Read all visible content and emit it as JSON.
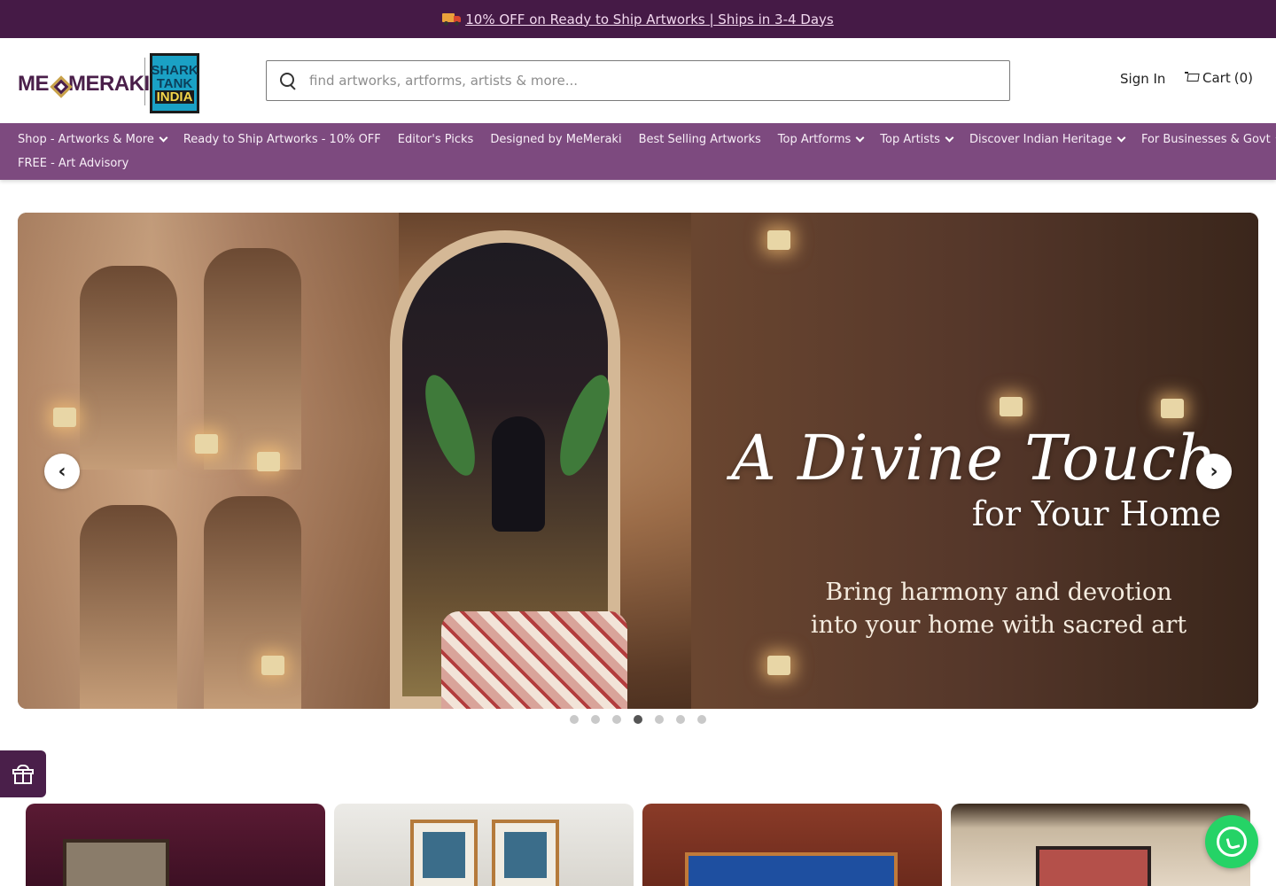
{
  "announcement": {
    "text": "10% OFF on Ready to Ship Artworks | Ships in 3-4 Days",
    "icon": "truck-icon"
  },
  "header": {
    "logo_text_left": "ME",
    "logo_text_right": "MERAKI",
    "badge_lines": [
      "SHARK",
      "TANK",
      "INDIA"
    ],
    "search_placeholder": "find artworks, artforms, artists & more...",
    "signin_label": "Sign In",
    "cart_label": "Cart",
    "cart_count": "(0)"
  },
  "nav": {
    "items": [
      {
        "label": "Shop - Artworks & More",
        "dropdown": true
      },
      {
        "label": "Ready to Ship Artworks - 10% OFF",
        "dropdown": false
      },
      {
        "label": "Editor's Picks",
        "dropdown": false
      },
      {
        "label": "Designed by MeMeraki",
        "dropdown": false
      },
      {
        "label": "Best Selling Artworks",
        "dropdown": false
      },
      {
        "label": "Top Artforms",
        "dropdown": true
      },
      {
        "label": "Top Artists",
        "dropdown": true
      },
      {
        "label": "Discover Indian Heritage",
        "dropdown": true
      },
      {
        "label": "For Businesses & Govt",
        "dropdown": true
      }
    ],
    "second_row": [
      {
        "label": "FREE - Art Advisory",
        "dropdown": false
      }
    ]
  },
  "hero": {
    "title": "A Divine Touch",
    "subtitle": "for Your Home",
    "description": "Bring harmony and devotion into your home with sacred art",
    "prev_label": "‹",
    "next_label": "›",
    "slide_count": 7,
    "active_slide": 4
  },
  "colors": {
    "announcement_bg": "#451a46",
    "nav_bg": "#7d4a7f",
    "brand": "#4a1f4a",
    "whatsapp": "#25d366"
  }
}
